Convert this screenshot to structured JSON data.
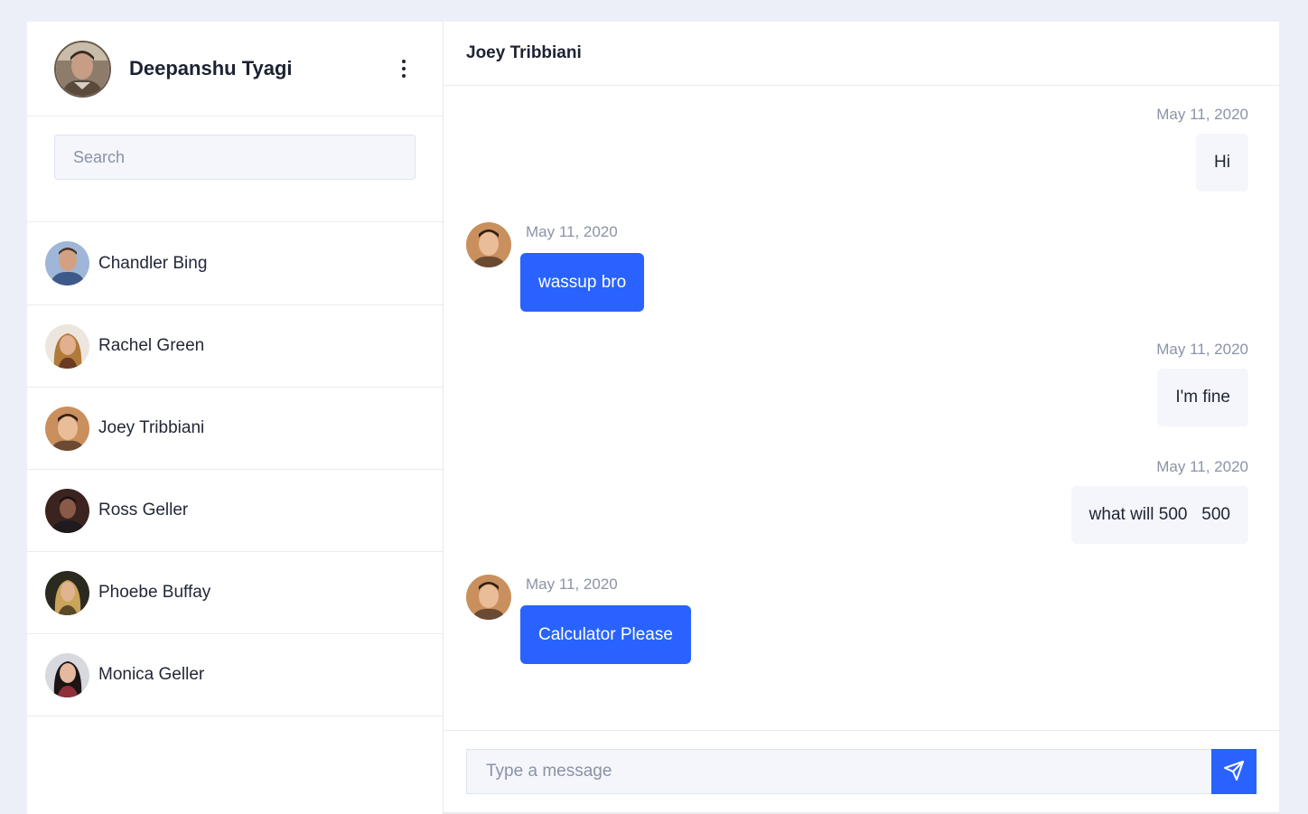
{
  "user": {
    "name": "Deepanshu Tyagi",
    "avatar": "user-avatar"
  },
  "search": {
    "placeholder": "Search",
    "value": ""
  },
  "contacts": [
    {
      "name": "Chandler Bing",
      "avatar": "chandler-avatar"
    },
    {
      "name": "Rachel Green",
      "avatar": "rachel-avatar"
    },
    {
      "name": "Joey Tribbiani",
      "avatar": "joey-avatar"
    },
    {
      "name": "Ross Geller",
      "avatar": "ross-avatar"
    },
    {
      "name": "Phoebe Buffay",
      "avatar": "phoebe-avatar"
    },
    {
      "name": "Monica Geller",
      "avatar": "monica-avatar"
    }
  ],
  "chat": {
    "title": "Joey Tribbiani",
    "messages": [
      {
        "side": "right",
        "date": "May 11, 2020",
        "text": "Hi"
      },
      {
        "side": "left",
        "date": "May 11, 2020",
        "text": "wassup bro"
      },
      {
        "side": "right",
        "date": "May 11, 2020",
        "text": "I'm fine"
      },
      {
        "side": "right",
        "date": "May 11, 2020",
        "text": "what will 500   500"
      },
      {
        "side": "left",
        "date": "May 11, 2020",
        "text": "Calculator Please"
      }
    ]
  },
  "composer": {
    "placeholder": "Type a message",
    "value": "",
    "send_icon": "send-icon"
  },
  "colors": {
    "accent": "#2962ff",
    "background": "#eceff7",
    "incoming_bubble": "#f4f6fb",
    "muted_text": "#8b93a7"
  }
}
